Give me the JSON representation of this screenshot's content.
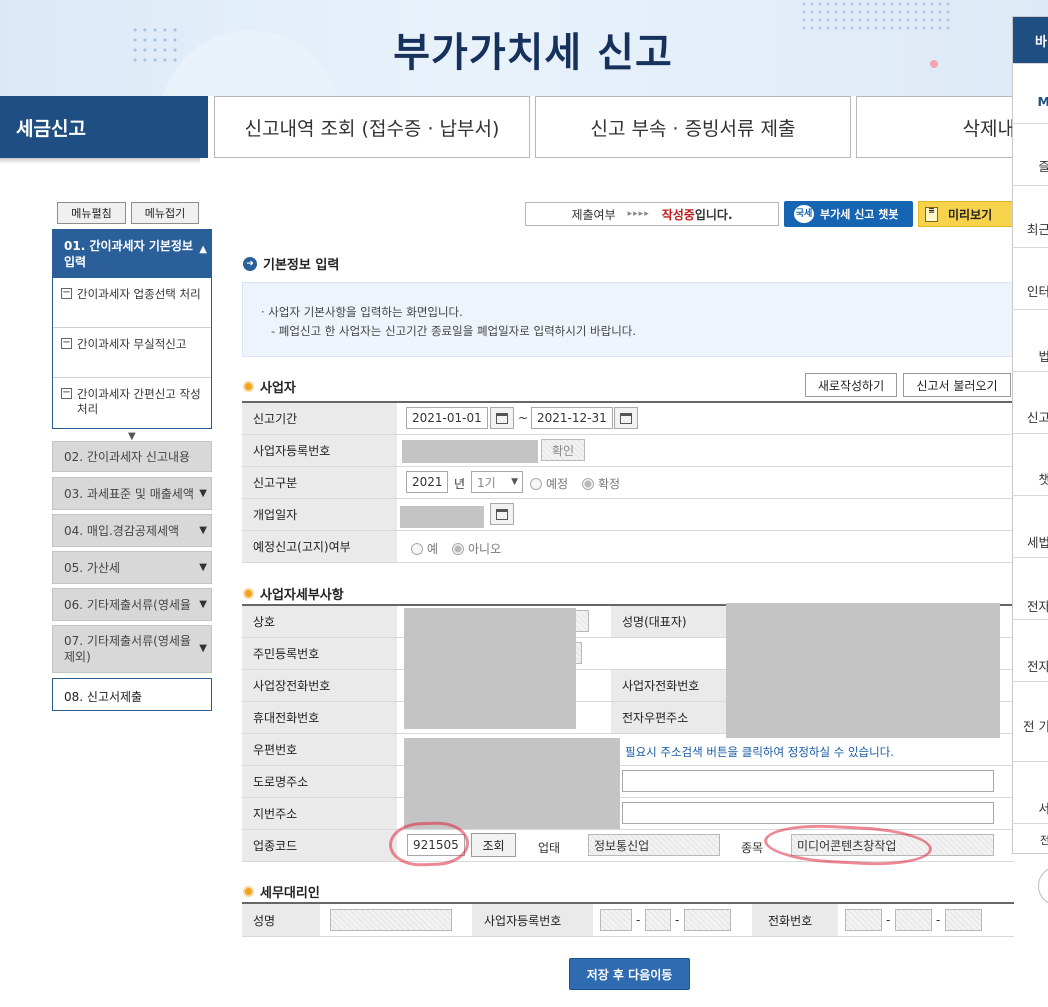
{
  "header": {
    "title": "부가가치세 신고"
  },
  "tabs": [
    {
      "label": "세금신고"
    },
    {
      "label": "신고내역 조회 (접수증 · 납부서)"
    },
    {
      "label": "신고 부속 · 증빙서류 제출"
    },
    {
      "label": "삭제내"
    }
  ],
  "sidebar": {
    "expand_label": "메뉴펼침",
    "collapse_label": "메뉴접기",
    "active_group": {
      "label": "01. 간이과세자 기본정보 입력",
      "items": [
        {
          "label": "간이과세자 업종선택 처리"
        },
        {
          "label": "간이과세자 무실적신고"
        },
        {
          "label": "간이과세자 간편신고 작성 처리"
        }
      ]
    },
    "items": [
      {
        "label": "02. 간이과세자 신고내용"
      },
      {
        "label": "03. 과세표준 및 매출세액"
      },
      {
        "label": "04. 매입.경감공제세액"
      },
      {
        "label": "05. 가산세"
      },
      {
        "label": "06. 기타제출서류(영세율"
      },
      {
        "label": "07. 기타제출서류(영세율 제외)"
      },
      {
        "label": "08. 신고서제출"
      }
    ]
  },
  "status": {
    "label": "제출여부",
    "arrows": "▸▸▸▸",
    "value_strong": "작성중",
    "value_suffix": "입니다."
  },
  "toolbar": {
    "chatbot_label": "부가세 신고 챗봇",
    "chatbot_icon": "국세",
    "preview_label": "미리보기"
  },
  "basic_info": {
    "title": "기본정보 입력",
    "desc_line1": "· 사업자 기본사항을 입력하는 화면입니다.",
    "desc_line2": "- 폐업신고 한 사업자는 신고기간 종료일을 폐업일자로 입력하시기 바랍니다."
  },
  "business": {
    "title": "사업자",
    "new_button": "새로작성하기",
    "load_button": "신고서 불러오기",
    "period_label": "신고기간",
    "period_from": "2021-01-01",
    "period_sep": "~",
    "period_to": "2021-12-31",
    "reg_no_label": "사업자등록번호",
    "confirm_button": "확인",
    "report_type_label": "신고구분",
    "year": "2021",
    "year_unit": "년",
    "term": "1기",
    "opt_scheduled": "예정",
    "opt_final": "확정",
    "open_date_label": "개업일자",
    "notice_label": "예정신고(고지)여부",
    "opt_yes": "예",
    "opt_no": "아니오"
  },
  "details": {
    "title": "사업자세부사항",
    "trade_name_label": "상호",
    "rep_name_label": "성명(대표자)",
    "resident_no_label": "주민등록번호",
    "biz_phone_label": "사업장전화번호",
    "owner_phone_label": "사업자전화번호",
    "mobile_label": "휴대전화번호",
    "email_label": "전자우편주소",
    "zip_label": "우편번호",
    "zip_note": "필요시 주소검색 버튼을 클릭하여 정정하실 수 있습니다.",
    "road_addr_label": "도로명주소",
    "lot_addr_label": "지번주소",
    "industry_code_label": "업종코드",
    "industry_code": "921505",
    "lookup_button": "조회",
    "business_type_label": "업태",
    "business_type": "정보통신업",
    "item_label": "종목",
    "item": "미디어콘텐츠창작업"
  },
  "agent": {
    "title": "세무대리인",
    "name_label": "성명",
    "reg_no_label": "사업자등록번호",
    "phone_label": "전화번호",
    "dash": "-"
  },
  "save_button": "저장 후 다음이동",
  "right_panel": {
    "head": "바",
    "items": [
      "M",
      "즐",
      "최근",
      "인터",
      "법",
      "신고",
      "챗",
      "세법",
      "전자",
      "전자",
      "전 기",
      "서",
      "전"
    ]
  },
  "colors": {
    "brand_dark": "#1f4e82",
    "brand": "#2b5f9a",
    "status_red": "#c01b1b",
    "chatbot_blue": "#1665b3",
    "preview_yellow": "#f6d34a",
    "bullet_orange": "#f2a21c"
  }
}
